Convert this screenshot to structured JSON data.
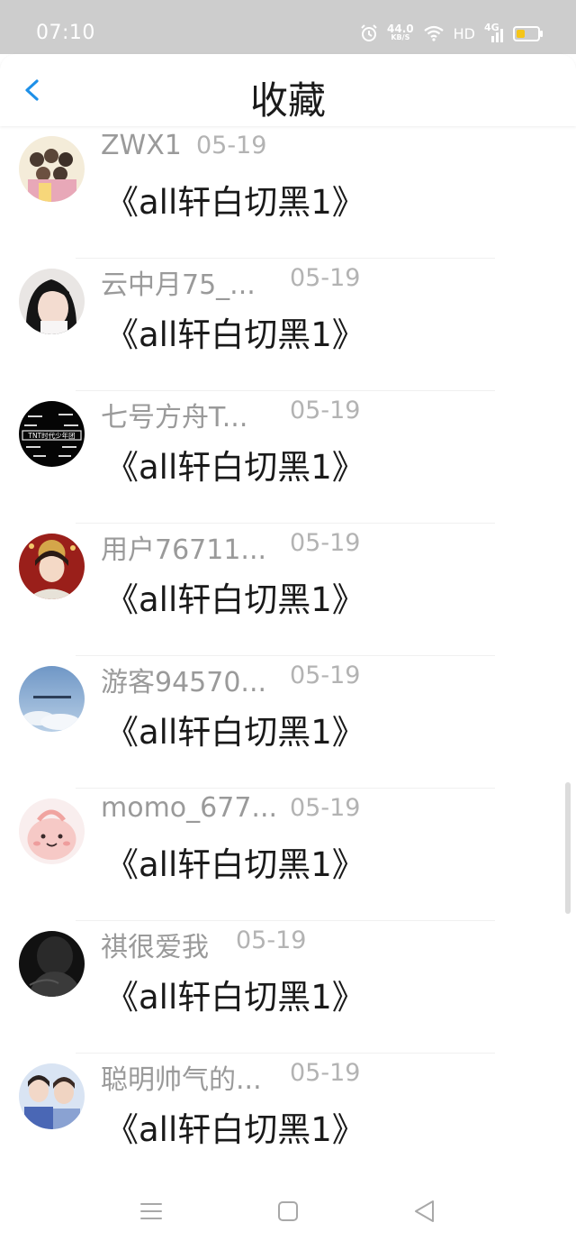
{
  "status_bar": {
    "time": "07:10",
    "speed_value": "44.0",
    "speed_unit": "KB/S",
    "hd": "HD",
    "network": "4G",
    "battery_color": "#f5c518"
  },
  "header": {
    "title": "收藏",
    "back_icon": "chevron-left-icon",
    "accent_color": "#1e90e8"
  },
  "items": [
    {
      "name": "ZWX1",
      "date": "05-19",
      "message": "《all轩白切黑1》"
    },
    {
      "name": "云中月75_...",
      "date": "05-19",
      "message": "《all轩白切黑1》"
    },
    {
      "name": "七号方舟T...",
      "date": "05-19",
      "message": "《all轩白切黑1》"
    },
    {
      "name": "用户76711...",
      "date": "05-19",
      "message": "《all轩白切黑1》"
    },
    {
      "name": "游客94570...",
      "date": "05-19",
      "message": "《all轩白切黑1》"
    },
    {
      "name": "momo_677...",
      "date": "05-19",
      "message": "《all轩白切黑1》"
    },
    {
      "name": "祺很爱我",
      "date": "05-19",
      "message": "《all轩白切黑1》"
    },
    {
      "name": "聪明帅气的...",
      "date": "05-19",
      "message": "《all轩白切黑1》"
    }
  ],
  "avatar_texts": {
    "tnt": "TNT时代少年团"
  },
  "nav": {
    "menu_icon": "menu-icon",
    "home_icon": "home-square-icon",
    "back_icon": "back-triangle-icon"
  }
}
